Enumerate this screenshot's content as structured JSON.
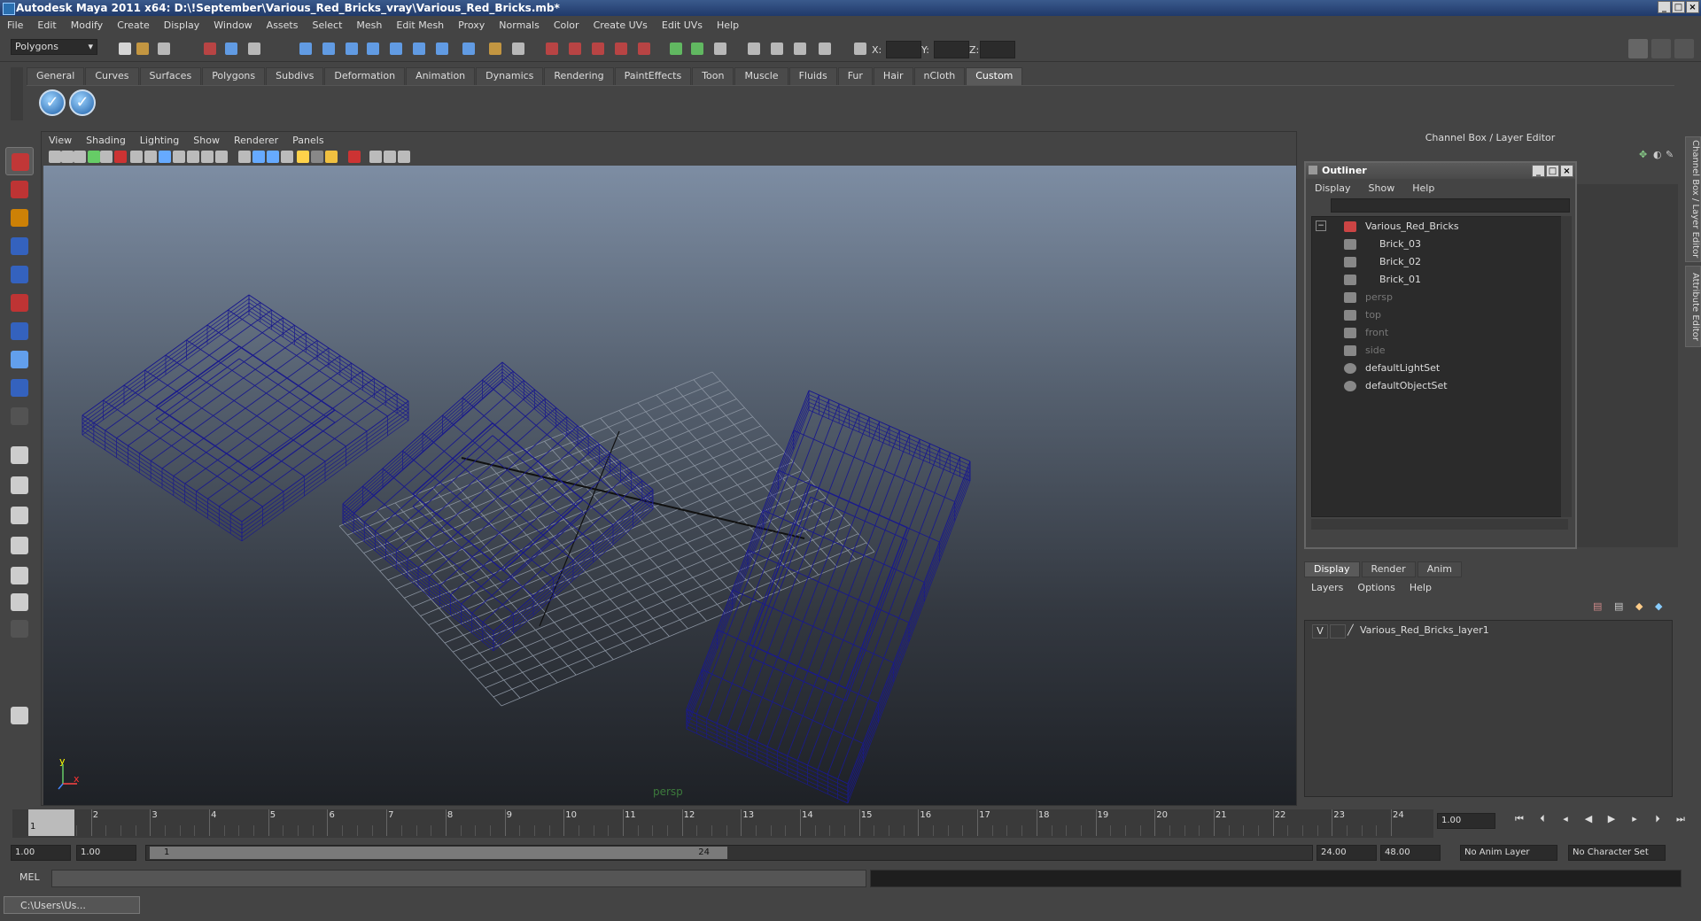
{
  "window": {
    "title": "Autodesk Maya 2011 x64: D:\\!September\\Various_Red_Bricks_vray\\Various_Red_Bricks.mb*"
  },
  "menubar": [
    "File",
    "Edit",
    "Modify",
    "Create",
    "Display",
    "Window",
    "Assets",
    "Select",
    "Mesh",
    "Edit Mesh",
    "Proxy",
    "Normals",
    "Color",
    "Create UVs",
    "Edit UVs",
    "Help"
  ],
  "statusline": {
    "mode": "Polygons",
    "x_label": "X:",
    "y_label": "Y:",
    "z_label": "Z:"
  },
  "shelf": {
    "tabs": [
      "General",
      "Curves",
      "Surfaces",
      "Polygons",
      "Subdivs",
      "Deformation",
      "Animation",
      "Dynamics",
      "Rendering",
      "PaintEffects",
      "Toon",
      "Muscle",
      "Fluids",
      "Fur",
      "Hair",
      "nCloth",
      "Custom"
    ],
    "active_tab": "Custom"
  },
  "viewport": {
    "menu": [
      "View",
      "Shading",
      "Lighting",
      "Show",
      "Renderer",
      "Panels"
    ],
    "camera_label": "persp",
    "axis_y": "y",
    "axis_x": "x"
  },
  "channelbox": {
    "header": "Channel Box / Layer Editor"
  },
  "outliner": {
    "title": "Outliner",
    "menu": [
      "Display",
      "Show",
      "Help"
    ],
    "items": [
      {
        "label": "Various_Red_Bricks",
        "dim": false
      },
      {
        "label": "Brick_03",
        "dim": false
      },
      {
        "label": "Brick_02",
        "dim": false
      },
      {
        "label": "Brick_01",
        "dim": false
      },
      {
        "label": "persp",
        "dim": true
      },
      {
        "label": "top",
        "dim": true
      },
      {
        "label": "front",
        "dim": true
      },
      {
        "label": "side",
        "dim": true
      },
      {
        "label": "defaultLightSet",
        "dim": false
      },
      {
        "label": "defaultObjectSet",
        "dim": false
      }
    ]
  },
  "layereditor": {
    "tabs": [
      "Display",
      "Render",
      "Anim"
    ],
    "menu": [
      "Layers",
      "Options",
      "Help"
    ],
    "layer_visible": "V",
    "layer_name": "Various_Red_Bricks_layer1"
  },
  "sidetabs": {
    "channel": "Channel Box / Layer Editor",
    "attribute": "Attribute Editor"
  },
  "timeslider": {
    "ticks": [
      "1",
      "2",
      "3",
      "4",
      "5",
      "6",
      "7",
      "8",
      "9",
      "10",
      "11",
      "12",
      "13",
      "14",
      "15",
      "16",
      "17",
      "18",
      "19",
      "20",
      "21",
      "22",
      "23",
      "24"
    ],
    "current_frame": "1",
    "current_field": "1.00"
  },
  "rangeslider": {
    "start": "1.00",
    "range_start": "1.00",
    "inner_start": "1",
    "inner_end": "24",
    "end": "24.00",
    "total_end": "48.00",
    "anim_layer": "No Anim Layer",
    "char_set": "No Character Set"
  },
  "cmdline": {
    "label": "MEL"
  },
  "taskbar": {
    "item": "C:\\Users\\Us..."
  }
}
